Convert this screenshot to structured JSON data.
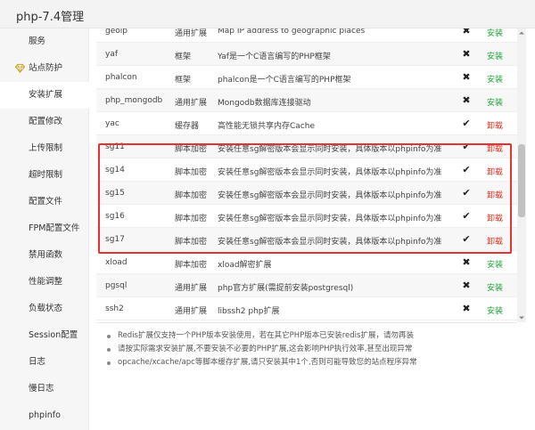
{
  "window": {
    "title": "php-7.4管理"
  },
  "sidebar": {
    "items": [
      {
        "label": "服务"
      },
      {
        "label": "站点防护",
        "icon": "diamond-icon"
      },
      {
        "label": "安装扩展",
        "active": true
      },
      {
        "label": "配置修改"
      },
      {
        "label": "上传限制"
      },
      {
        "label": "超时限制"
      },
      {
        "label": "配置文件"
      },
      {
        "label": "FPM配置文件"
      },
      {
        "label": "禁用函数"
      },
      {
        "label": "性能调整"
      },
      {
        "label": "负载状态"
      },
      {
        "label": "Session配置"
      },
      {
        "label": "日志"
      },
      {
        "label": "慢日志"
      },
      {
        "label": "phpinfo"
      }
    ]
  },
  "extensions": {
    "rows": [
      {
        "name": "geoip",
        "type": "通用扩展",
        "desc": "Map IP address to geographic places",
        "status": "✖",
        "action": "安装",
        "action_kind": "install"
      },
      {
        "name": "yaf",
        "type": "框架",
        "desc": "Yaf是一个C语言编写的PHP框架",
        "status": "✖",
        "action": "安装",
        "action_kind": "install"
      },
      {
        "name": "phalcon",
        "type": "框架",
        "desc": "phalcon是一个C语言编写的PHP框架",
        "status": "✖",
        "action": "安装",
        "action_kind": "install"
      },
      {
        "name": "php_mongodb",
        "type": "通用扩展",
        "desc": "Mongodb数据库连接驱动",
        "status": "✖",
        "action": "安装",
        "action_kind": "install"
      },
      {
        "name": "yac",
        "type": "缓存器",
        "desc": "高性能无锁共享内存Cache",
        "status": "✔",
        "action": "卸载",
        "action_kind": "uninstall"
      },
      {
        "name": "sg11",
        "type": "脚本加密",
        "desc": "安装任意sg解密版本会显示同时安装，具体版本以phpinfo为准",
        "status": "✔",
        "action": "卸载",
        "action_kind": "uninstall"
      },
      {
        "name": "sg14",
        "type": "脚本加密",
        "desc": "安装任意sg解密版本会显示同时安装，具体版本以phpinfo为准",
        "status": "✔",
        "action": "卸载",
        "action_kind": "uninstall"
      },
      {
        "name": "sg15",
        "type": "脚本加密",
        "desc": "安装任意sg解密版本会显示同时安装，具体版本以phpinfo为准",
        "status": "✔",
        "action": "卸载",
        "action_kind": "uninstall"
      },
      {
        "name": "sg16",
        "type": "脚本加密",
        "desc": "安装任意sg解密版本会显示同时安装，具体版本以phpinfo为准",
        "status": "✔",
        "action": "卸载",
        "action_kind": "uninstall"
      },
      {
        "name": "sg17",
        "type": "脚本加密",
        "desc": "安装任意sg解密版本会显示同时安装，具体版本以phpinfo为准",
        "status": "✔",
        "action": "卸载",
        "action_kind": "uninstall"
      },
      {
        "name": "xload",
        "type": "脚本加密",
        "desc": "xload解密扩展",
        "status": "✖",
        "action": "安装",
        "action_kind": "install"
      },
      {
        "name": "pgsql",
        "type": "通用扩展",
        "desc": "php官方扩展(需提前安装postgresql)",
        "status": "✖",
        "action": "安装",
        "action_kind": "install"
      },
      {
        "name": "ssh2",
        "type": "通用扩展",
        "desc": "libssh2 php扩展",
        "status": "✖",
        "action": "安装",
        "action_kind": "install"
      }
    ]
  },
  "notes": [
    "Redis扩展仅支持一个PHP版本安装使用，若在其它PHP版本已安装redis扩展，请勿再装",
    "请按实际需求安装扩展,不要安装不必要的PHP扩展,这会影响PHP执行效率,甚至出现异常",
    "opcache/xcache/apc等脚本缓存扩展,请只安装其中1个,否则可能导致您的站点程序异常"
  ],
  "colors": {
    "install": "#20a53a",
    "uninstall": "#e0301e",
    "highlight": "#e53232"
  }
}
